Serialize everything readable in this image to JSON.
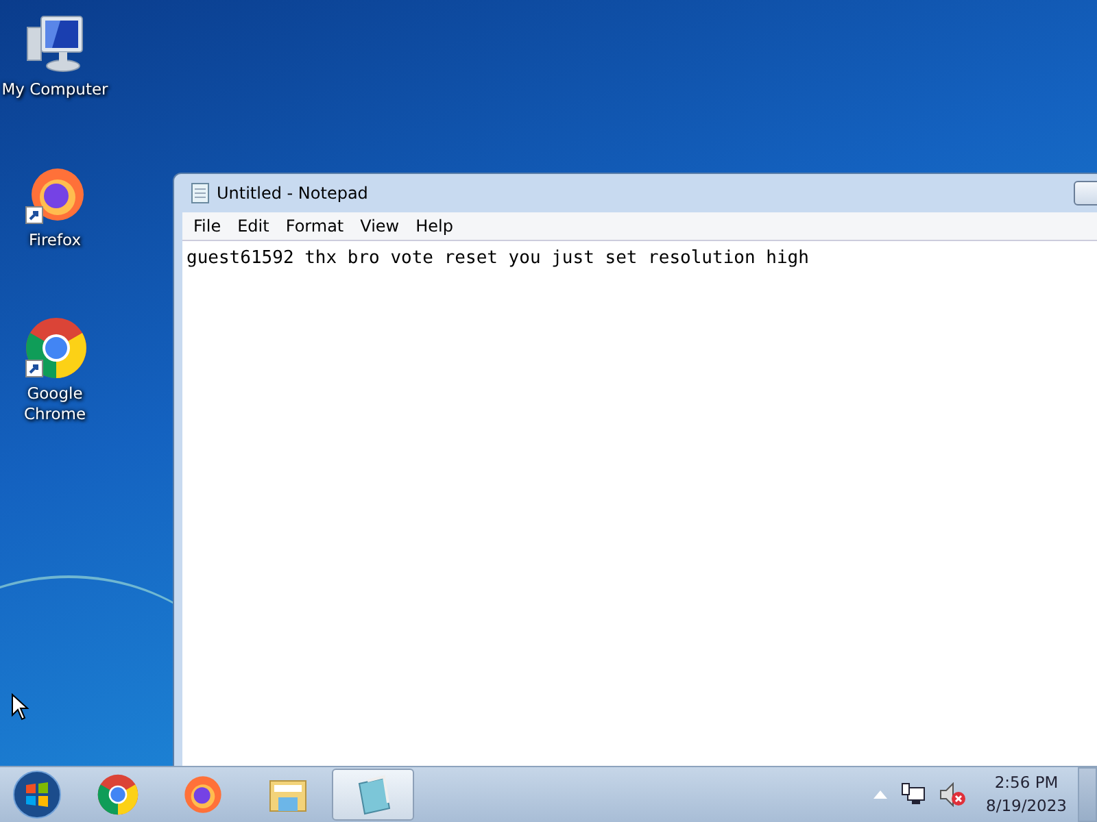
{
  "desktop_icons": [
    {
      "kind": "computer",
      "label": "My Computer"
    },
    {
      "kind": "firefox",
      "label": "Firefox"
    },
    {
      "kind": "chrome",
      "label": "Google Chrome"
    }
  ],
  "notepad": {
    "title": "Untitled - Notepad",
    "menu": [
      "File",
      "Edit",
      "Format",
      "View",
      "Help"
    ],
    "text": "guest61592 thx bro vote reset you just set resolution high"
  },
  "taskbar": {
    "items": [
      {
        "kind": "chrome",
        "selected": false
      },
      {
        "kind": "firefox",
        "selected": false
      },
      {
        "kind": "folder",
        "selected": false
      },
      {
        "kind": "notepad",
        "selected": true
      }
    ],
    "volume_muted": true,
    "time": "2:56 PM",
    "date": "8/19/2023"
  }
}
